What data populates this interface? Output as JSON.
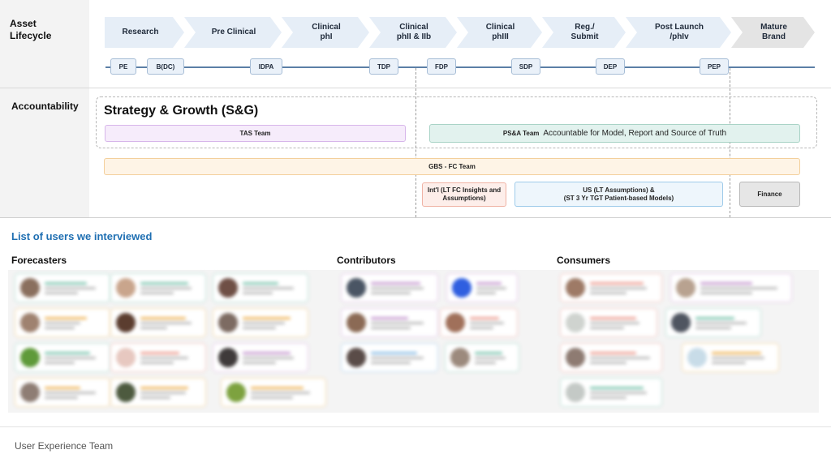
{
  "rows": {
    "asset_lifecycle": "Asset\nLifecycle",
    "accountability": "Accountability"
  },
  "phases": [
    {
      "label": "Research"
    },
    {
      "label": "Pre Clinical"
    },
    {
      "label": "Clinical\nphI"
    },
    {
      "label": "Clinical\nphII & IIb"
    },
    {
      "label": "Clinical\nphIII"
    },
    {
      "label": "Reg./\nSubmit"
    },
    {
      "label": "Post Launch\n/phIv"
    },
    {
      "label": "Mature\nBrand"
    }
  ],
  "gates": [
    "PE",
    "B(DC)",
    "IDPA",
    "TDP",
    "FDP",
    "SDP",
    "DEP",
    "PEP"
  ],
  "strategy_group": {
    "title": "Strategy & Growth (S&G)",
    "tas_team": "TAS Team",
    "psa_team": "PS&A Team",
    "psa_desc": "Accountable for Model, Report and Source of Truth"
  },
  "gbs_team": "GBS - FC Team",
  "intl": "Int'l (LT FC Insights and\nAssumptions)",
  "us": "US (LT Assumptions) &\n(ST 3 Yr TGT Patient-based Models)",
  "finance": "Finance",
  "users_section": {
    "title": "List of users we interviewed",
    "forecasters": "Forecasters",
    "contributors": "Contributors",
    "consumers": "Consumers"
  },
  "colors": {
    "chevron": "#e6eef7",
    "chevron_last": "#e4e4e4",
    "tas": "#f6ecfb",
    "psa": "#e2f2ee",
    "gbs": "#fef4e6",
    "intl": "#fdeeea",
    "us": "#eef6fc",
    "finance": "#e6e6e6",
    "section_title": "#1f6fb2"
  },
  "footer": "User Experience Team"
}
